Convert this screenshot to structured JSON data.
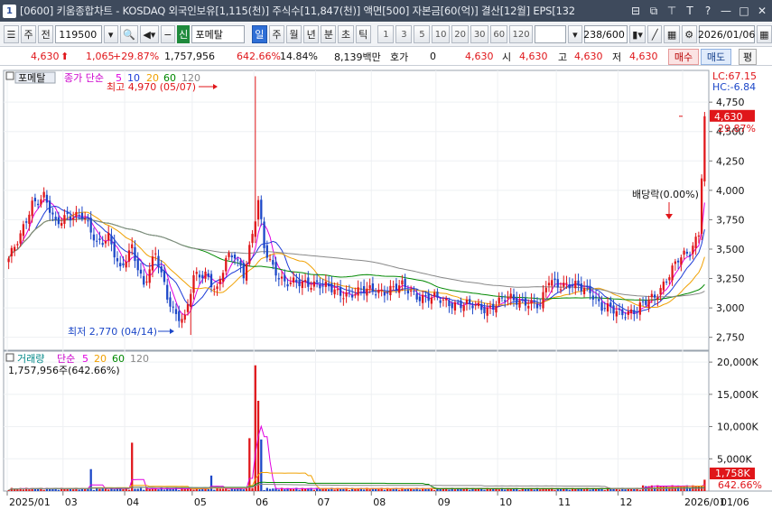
{
  "window": {
    "number": "1",
    "title": "[0600] 키움종합차트 - KOSDAQ 외국인보유[1,115(천)] 주식수[11,847(천)] 액면[500] 자본금[60(억)] 결산[12월] EPS[132",
    "buttons": [
      "⊟",
      "⧉",
      "⊤",
      "T",
      "?",
      "—",
      "□",
      "✕"
    ]
  },
  "toolbar": {
    "main_button": "주",
    "prev_button": "전",
    "code_value": "119500",
    "new_badge": "신",
    "stock_name": "포메탈",
    "period_buttons": [
      "일",
      "주",
      "월",
      "년",
      "분",
      "초",
      "틱"
    ],
    "active_period": "일",
    "minute_options": [
      "1",
      "3",
      "5",
      "10",
      "20",
      "30",
      "60",
      "120"
    ],
    "count_value": "238",
    "count_total": "/600",
    "date_value": "2026/01/06"
  },
  "infobar": {
    "price": "4,630",
    "change": "1,065",
    "change_pct": "+29.87%",
    "volume": "1,757,956",
    "volume_pct": "642.66%",
    "turnover": "14.84%",
    "amount": "8,139백만",
    "quote_label": "호가",
    "quote_value": "0",
    "quote_price": "4,630",
    "open_label": "시",
    "open_value": "4,630",
    "high_label": "고",
    "high_value": "4,630",
    "low_label": "저",
    "low_value": "4,630",
    "buy_label": "매수",
    "sell_label": "매도",
    "eval_label": "평"
  },
  "price_pane": {
    "title": "포메탈",
    "legend_prefix": "종가 단순",
    "ma_labels": [
      "5",
      "10",
      "20",
      "60",
      "120"
    ],
    "ma_colors": [
      "#e000e0",
      "#1e3cd8",
      "#f0a000",
      "#008800",
      "#888888"
    ],
    "lc": "LC:67.15",
    "hc": "HC:-6.84",
    "current_price_label": "4,630",
    "current_change_label": "29.87%",
    "max_annotation": "최고 4,970 (05/07)",
    "min_annotation": "최저 2,770 (04/14)",
    "dividend_annotation": "배당락(0.00%)"
  },
  "volume_pane": {
    "title": "거래량",
    "legend_prefix": "단순",
    "ma_labels": [
      "5",
      "20",
      "60",
      "120"
    ],
    "value_label": "1,757,956주(642.66%)",
    "current_label": "1,758K",
    "current_pct": "642.66%"
  },
  "x_axis_labels": [
    "2025/01",
    "03",
    "04",
    "05",
    "06",
    "07",
    "08",
    "09",
    "10",
    "11",
    "12",
    "2026/01",
    "01/06"
  ],
  "colors": {
    "up": "#e0161a",
    "down": "#1c47c8",
    "accent": "#2f6fd6"
  },
  "chart_data": {
    "type": "candlestick",
    "price_axis": {
      "ticks": [
        2750,
        3000,
        3250,
        3500,
        3750,
        4000,
        4250,
        4500,
        4750
      ],
      "ylim": [
        2640,
        5020
      ]
    },
    "volume_axis": {
      "ticks": [
        "5,000K",
        "10,000K",
        "15,000K",
        "20,000K"
      ],
      "tick_values": [
        5000,
        10000,
        15000,
        20000
      ],
      "ylim": [
        0,
        21000
      ],
      "unit": "K shares"
    },
    "high": {
      "value": 4970,
      "date": "05/07"
    },
    "low": {
      "value": 2770,
      "date": "04/14"
    },
    "last": {
      "close": 4630,
      "change": 1065,
      "change_pct": 29.87,
      "volume": 1757956
    },
    "close_anchors": [
      [
        0,
        3420
      ],
      [
        4,
        3600
      ],
      [
        8,
        3900
      ],
      [
        12,
        3950
      ],
      [
        16,
        3700
      ],
      [
        20,
        3800
      ],
      [
        25,
        3780
      ],
      [
        30,
        3550
      ],
      [
        34,
        3620
      ],
      [
        38,
        3300
      ],
      [
        42,
        3520
      ],
      [
        46,
        3200
      ],
      [
        50,
        3450
      ],
      [
        54,
        3100
      ],
      [
        57,
        2950
      ],
      [
        60,
        2900
      ],
      [
        63,
        3250
      ],
      [
        67,
        3300
      ],
      [
        71,
        3150
      ],
      [
        74,
        3400
      ],
      [
        77,
        3450
      ],
      [
        80,
        3300
      ],
      [
        83,
        3620
      ],
      [
        85,
        3900
      ],
      [
        87,
        3500
      ],
      [
        90,
        3350
      ],
      [
        94,
        3220
      ],
      [
        98,
        3200
      ],
      [
        105,
        3220
      ],
      [
        112,
        3120
      ],
      [
        120,
        3140
      ],
      [
        128,
        3150
      ],
      [
        134,
        3180
      ],
      [
        140,
        3100
      ],
      [
        148,
        3060
      ],
      [
        156,
        3020
      ],
      [
        163,
        3000
      ],
      [
        170,
        3080
      ],
      [
        176,
        3060
      ],
      [
        181,
        3000
      ],
      [
        184,
        3250
      ],
      [
        188,
        3200
      ],
      [
        192,
        3180
      ],
      [
        198,
        3160
      ],
      [
        202,
        3000
      ],
      [
        208,
        2960
      ],
      [
        214,
        2980
      ],
      [
        220,
        3100
      ],
      [
        224,
        3250
      ],
      [
        228,
        3400
      ],
      [
        232,
        3480
      ],
      [
        235,
        3650
      ],
      [
        237,
        4630
      ]
    ],
    "volume_spikes": [
      [
        28,
        3400
      ],
      [
        42,
        7500
      ],
      [
        69,
        2400
      ],
      [
        82,
        8200
      ],
      [
        84,
        19500
      ],
      [
        85,
        14000
      ],
      [
        86,
        8000
      ],
      [
        237,
        1758
      ]
    ]
  }
}
